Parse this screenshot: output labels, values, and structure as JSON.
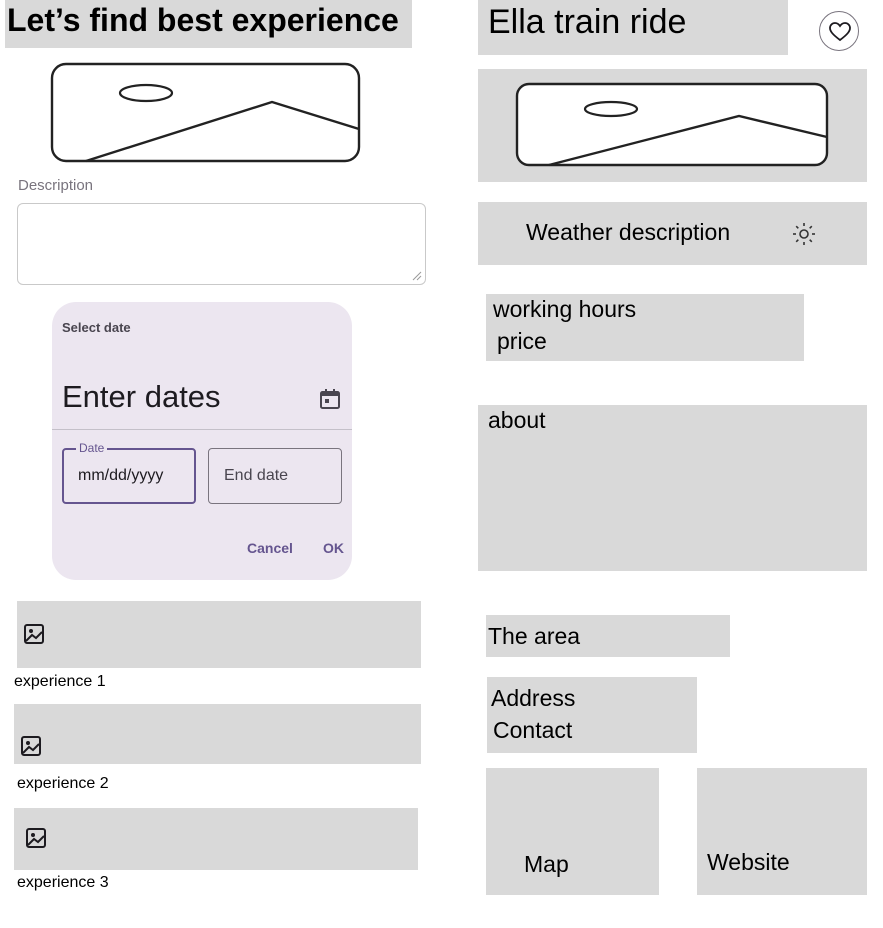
{
  "left": {
    "title": "Let’s find best experience",
    "description_label": "Description",
    "description_value": "",
    "date_picker": {
      "header": "Select date",
      "headline": "Enter dates",
      "start_label": "Date",
      "start_placeholder": "mm/dd/yyyy",
      "end_placeholder": "End date",
      "cancel": "Cancel",
      "ok": "OK"
    },
    "experiences": [
      {
        "label": "experience 1"
      },
      {
        "label": "experience 2"
      },
      {
        "label": "experience 3"
      }
    ]
  },
  "right": {
    "title": "Ella train ride",
    "weather": "Weather description",
    "working_hours": "working hours",
    "price": "price",
    "about": "about",
    "area": "The area",
    "address": "Address",
    "contact": "Contact",
    "map": "Map",
    "website": "Website"
  },
  "icons": {
    "favorite": "heart-outline-icon",
    "weather": "sun-icon",
    "calendar": "calendar-icon",
    "image": "image-icon"
  },
  "colors": {
    "placeholder_gray": "#d9d9d9",
    "picker_bg": "#ece6f0",
    "accent": "#65558f"
  }
}
